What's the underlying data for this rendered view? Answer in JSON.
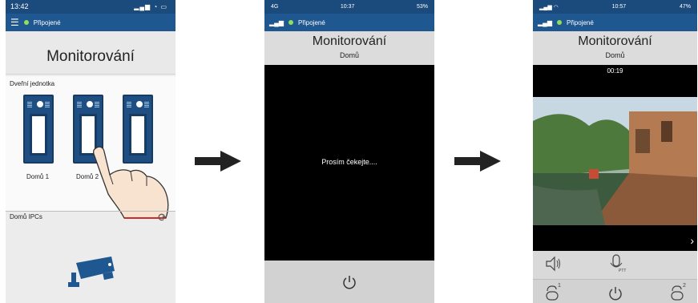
{
  "screen1": {
    "time": "13:42",
    "signal_icon": "signal-wifi-battery-icon",
    "menu_icon": "hamburger-menu-icon",
    "connection_status": "Připojené",
    "title": "Monitorování",
    "section_door": "Dveřní jednotka",
    "door_units": [
      {
        "label": "Domů 1"
      },
      {
        "label": "Domů 2"
      },
      {
        "label": ""
      }
    ],
    "section_ipc": "Domů IPCs",
    "refresh_icon": "refresh-icon",
    "camera_icon": "cctv-camera-icon",
    "hand_icon": "pointing-hand-icon"
  },
  "screen2": {
    "network": "4G",
    "time": "10:37",
    "battery": "53%",
    "connection_status": "Připojené",
    "title": "Monitorování",
    "subtitle": "Domů",
    "waiting_text": "Prosím čekejte....",
    "power_icon": "power-icon"
  },
  "screen3": {
    "time": "10:57",
    "battery": "47%",
    "connection_status": "Připojené",
    "title": "Monitorování",
    "subtitle": "Domů",
    "duration": "00:19",
    "next_icon": "chevron-right-icon",
    "speaker_icon": "speaker-icon",
    "mic_icon": "microphone-ptt-icon",
    "mic_label": "PTT",
    "unlock1_icon": "unlock-1-icon",
    "unlock1_num": "1",
    "power_icon": "power-icon",
    "unlock2_icon": "unlock-2-icon",
    "unlock2_num": "2"
  },
  "flow": {
    "arrow_icon": "right-arrow-icon"
  }
}
